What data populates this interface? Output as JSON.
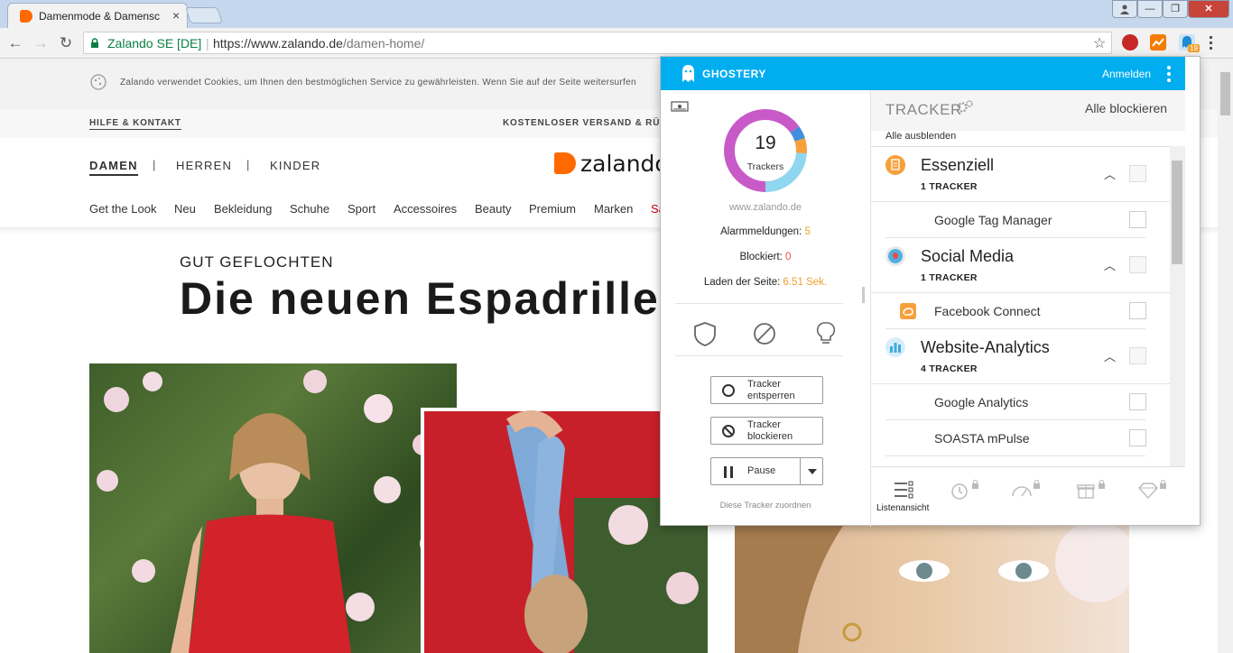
{
  "browser": {
    "tab_title": "Damenmode & Damensc",
    "tab_close": "×",
    "identity": "Zalando SE [DE]",
    "url_host": "https://www.zalando.de",
    "url_path": "/damen-home/",
    "extension_badge": "19",
    "window_buttons": {
      "minimize": "—",
      "maximize": "❐",
      "close": "✕"
    },
    "nav": {
      "back": "←",
      "forward": "→",
      "reload": "↻",
      "star": "☆"
    }
  },
  "page": {
    "cookie_text": "Zalando verwendet Cookies, um Ihnen den bestmöglichen Service zu gewährleisten. Wenn Sie auf der Seite weitersurfen",
    "help_link": "HILFE & KONTAKT",
    "shipping": "KOSTENLOSER VERSAND & RÜC",
    "genders": [
      "DAMEN",
      "HERREN",
      "KINDER"
    ],
    "gender_separator": "|",
    "logo_text": "zalando",
    "categories": [
      "Get the Look",
      "Neu",
      "Bekleidung",
      "Schuhe",
      "Sport",
      "Accessoires",
      "Beauty",
      "Premium",
      "Marken",
      "Sa"
    ],
    "hero_kicker": "GUT GEFLOCHTEN",
    "hero_title": "Die neuen Espadrille"
  },
  "ghostery": {
    "brand": "GHOSTERY",
    "signin": "Anmelden",
    "donut": {
      "count": "19",
      "label": "Trackers",
      "segments": [
        {
          "color": "#c85ac8",
          "value": 0.65
        },
        {
          "color": "#3f8ee0",
          "value": 0.05
        },
        {
          "color": "#f6a03c",
          "value": 0.06
        },
        {
          "color": "#8fd6ef",
          "value": 0.24
        }
      ]
    },
    "site": "www.zalando.de",
    "alarms_label": "Alarmmeldungen:",
    "alarms_value": "5",
    "blocked_label": "Blockiert:",
    "blocked_value": "0",
    "load_label": "Laden der Seite:",
    "load_value": "6.51 Sek.",
    "actions": [
      {
        "line1": "Tracker",
        "line2": "entsperren"
      },
      {
        "line1": "Tracker",
        "line2": "blockieren"
      }
    ],
    "pause_label": "Pause",
    "map_trackers": "Diese Tracker zuordnen",
    "tracker_title": "TRACKER",
    "block_all": "Alle blockieren",
    "hide_all": "Alle ausblenden",
    "categories": [
      {
        "name": "Essenziell",
        "count": "1 TRACKER",
        "icon_color": "#f6a03c",
        "trackers": [
          "Google Tag Manager"
        ]
      },
      {
        "name": "Social Media",
        "count": "1 TRACKER",
        "icon_color": "#e86a8a",
        "trackers": [
          "Facebook Connect"
        ]
      },
      {
        "name": "Website-Analytics",
        "count": "4 TRACKER",
        "icon_color": "#3fa9e0",
        "trackers": [
          "Google Analytics",
          "SOASTA mPulse"
        ]
      }
    ],
    "footer_label": "Listenansicht"
  }
}
